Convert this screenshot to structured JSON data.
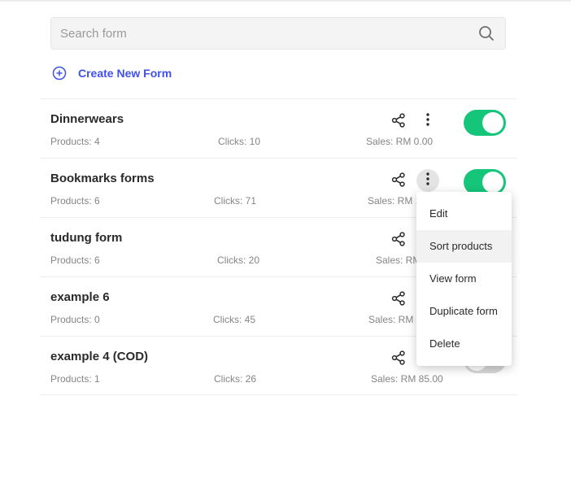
{
  "search": {
    "placeholder": "Search form",
    "icon": "search-icon"
  },
  "create_form": {
    "label": "Create New Form",
    "icon": "plus-circle-icon",
    "color": "#3f51e8"
  },
  "accent": {
    "toggle_on": "#15c57a",
    "toggle_off": "#d7d7d7"
  },
  "forms": [
    {
      "name": "Dinnerwears",
      "products": "Products: 4",
      "clicks": "Clicks: 10",
      "sales": "Sales: RM 0.00",
      "enabled": true,
      "menu_open": false
    },
    {
      "name": "Bookmarks forms",
      "products": "Products: 6",
      "clicks": "Clicks: 71",
      "sales": "Sales: RM 1",
      "enabled": true,
      "menu_open": true
    },
    {
      "name": "tudung form",
      "products": "Products: 6",
      "clicks": "Clicks: 20",
      "sales": "Sales: RM",
      "enabled": true,
      "menu_open": false
    },
    {
      "name": "example 6",
      "products": "Products: 0",
      "clicks": "Clicks: 45",
      "sales": "Sales: RM 1",
      "enabled": true,
      "menu_open": false
    },
    {
      "name": "example 4 (COD)",
      "products": "Products: 1",
      "clicks": "Clicks: 26",
      "sales": "Sales: RM 85.00",
      "enabled": false,
      "menu_open": false
    }
  ],
  "context_menu": {
    "items": [
      "Edit",
      "Sort products",
      "View form",
      "Duplicate form",
      "Delete"
    ],
    "highlighted": "Sort products"
  }
}
